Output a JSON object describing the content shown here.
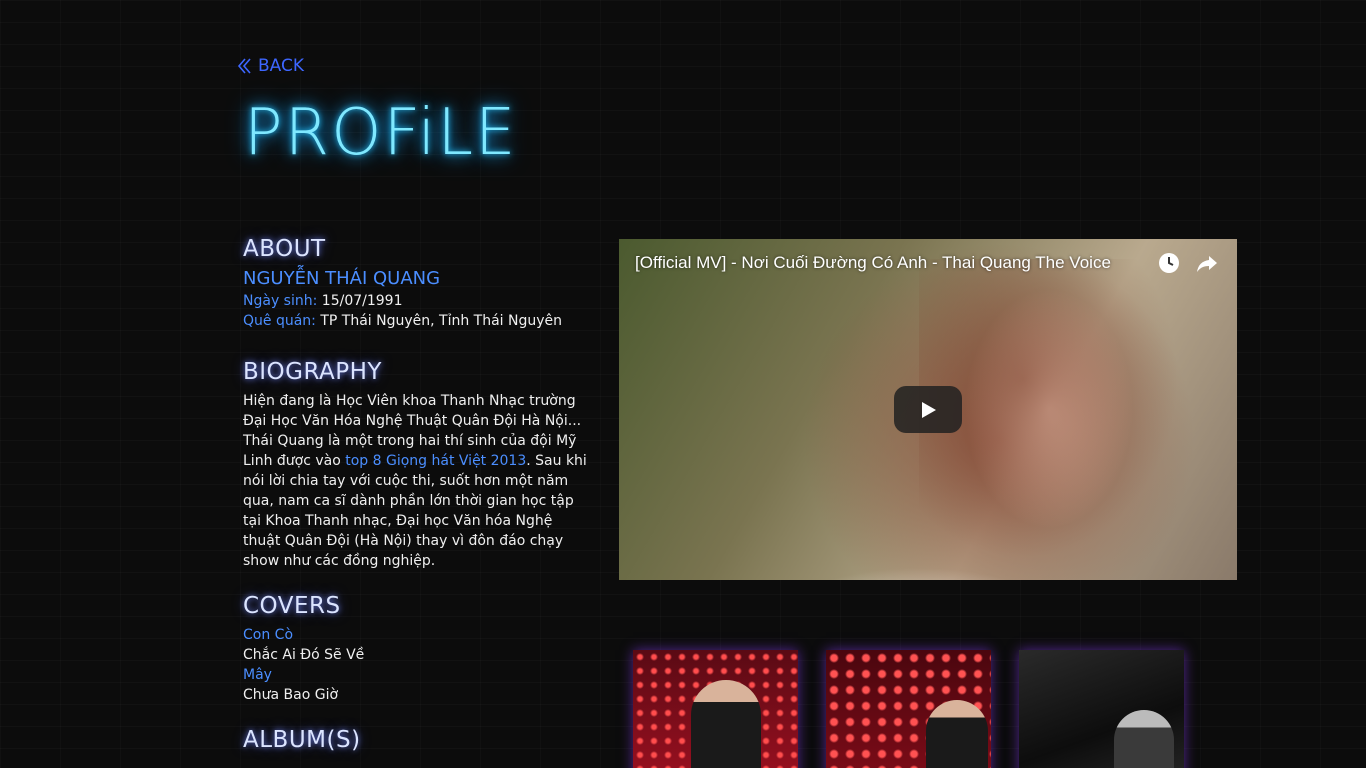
{
  "nav": {
    "back_label": "BACK"
  },
  "page": {
    "title": "PROFiLE"
  },
  "about": {
    "heading": "ABOUT",
    "name": "NGUYỄN THÁI QUANG",
    "birth_label": "Ngày sinh:",
    "birth_value": "15/07/1991",
    "hometown_label": "Quê quán:",
    "hometown_value": "TP Thái Nguyên, Tỉnh Thái Nguyên"
  },
  "biography": {
    "heading": "BIOGRAPHY",
    "text_before": "Hiện đang là Học Viên khoa Thanh Nhạc trường Đại Học Văn Hóa Nghệ Thuật Quân Đội Hà Nội... Thái Quang là một trong hai thí sinh của đội Mỹ Linh được vào ",
    "highlight": "top 8 Giọng hát Việt 2013",
    "text_after": ". Sau khi nói lời chia tay với cuộc thi, suốt hơn một năm qua, nam ca sĩ dành phần lớn thời gian học tập tại Khoa Thanh nhạc, Đại học Văn hóa Nghệ thuật Quân Đội (Hà Nội) thay vì đôn đáo chạy show như các đồng nghiệp."
  },
  "covers": {
    "heading": "COVERS",
    "items": [
      "Con Cò",
      "Chắc Ai Đó Sẽ Về",
      "Mây",
      "Chưa Bao Giờ"
    ]
  },
  "albums": {
    "heading": "ALBUM(S)"
  },
  "video": {
    "title": "[Official MV] - Nơi Cuối Đường Có Anh - Thai Quang The Voice",
    "icons": [
      "watch-later-icon",
      "share-icon",
      "play-icon"
    ]
  },
  "colors": {
    "accent_blue": "#4b8eff",
    "neon_title": "#7fe8ff",
    "back_link": "#3d66ff"
  }
}
